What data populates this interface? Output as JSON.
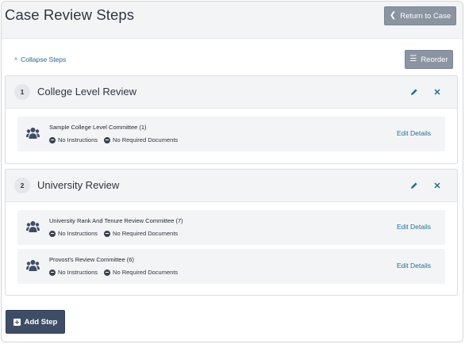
{
  "header": {
    "title": "Case Review Steps",
    "return_label": "Return to Case",
    "return_icon": "chevron-left-icon"
  },
  "toolbar": {
    "collapse_label": "Collapse Steps",
    "collapse_icon": "double-chevron-up-icon",
    "reorder_label": "Reorder",
    "reorder_icon": "bars-icon"
  },
  "steps": [
    {
      "number": "1",
      "title": "College Level Review",
      "committees": [
        {
          "name": "Sample College Level Committee (1)",
          "instructions": "No Instructions",
          "documents": "No Required Documents",
          "edit_label": "Edit Details"
        }
      ]
    },
    {
      "number": "2",
      "title": "University Review",
      "committees": [
        {
          "name": "University Rank And Tenure Review Committee (7)",
          "instructions": "No Instructions",
          "documents": "No Required Documents",
          "edit_label": "Edit Details"
        },
        {
          "name": "Provost's Review Committee (6)",
          "instructions": "No Instructions",
          "documents": "No Required Documents",
          "edit_label": "Edit Details"
        }
      ]
    }
  ],
  "footer": {
    "add_step_label": "Add Step",
    "add_step_icon": "plus-square-icon"
  },
  "colors": {
    "link": "#1f6f9d",
    "primary_button": "#3f4c66",
    "secondary_button": "#8b94a1",
    "panel_background": "#f3f4f5"
  }
}
